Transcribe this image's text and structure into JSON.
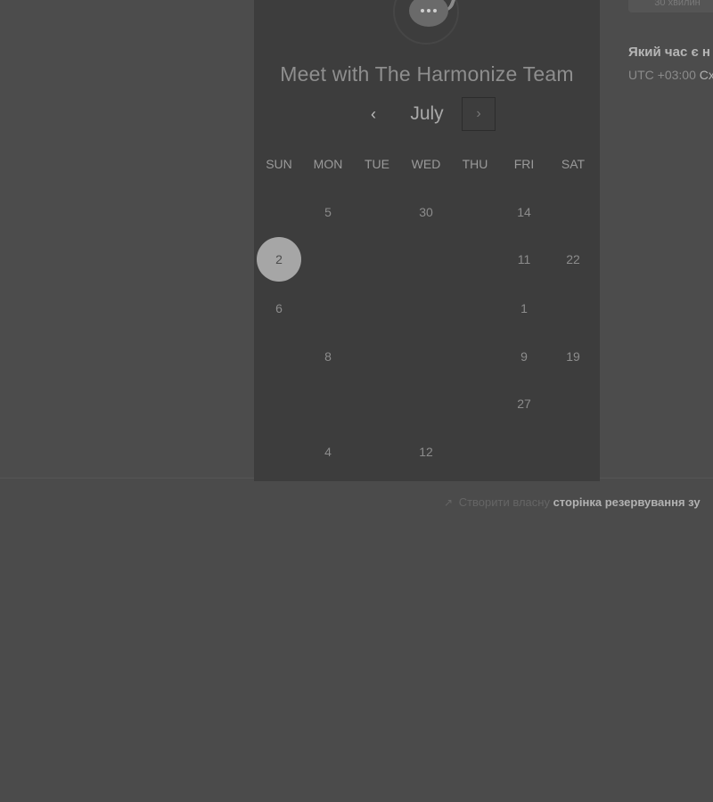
{
  "panel": {
    "title": "Meet with The Harmonize Team",
    "month": "July",
    "prev_icon": "‹",
    "next_icon": "›",
    "weekdays": [
      "SUN",
      "MON",
      "TUE",
      "WED",
      "THU",
      "FRI",
      "SAT"
    ],
    "days": [
      {
        "label": "5",
        "column": "MON",
        "row": 1,
        "selected": false
      },
      {
        "label": "30",
        "column": "WED",
        "row": 1,
        "selected": false
      },
      {
        "label": "14",
        "column": "FRI",
        "row": 1,
        "selected": false
      },
      {
        "label": "2",
        "column": "SUN",
        "row": 2,
        "selected": true
      },
      {
        "label": "11",
        "column": "FRI",
        "row": 2,
        "selected": false
      },
      {
        "label": "22",
        "column": "SAT",
        "row": 2,
        "selected": false
      },
      {
        "label": "6",
        "column": "SUN",
        "row": 3,
        "selected": false
      },
      {
        "label": "1",
        "column": "FRI",
        "row": 3,
        "selected": false
      },
      {
        "label": "8",
        "column": "MON",
        "row": 4,
        "selected": false
      },
      {
        "label": "9",
        "column": "FRI",
        "row": 4,
        "selected": false
      },
      {
        "label": "19",
        "column": "SAT",
        "row": 4,
        "selected": false
      },
      {
        "label": "27",
        "column": "FRI",
        "row": 5,
        "selected": false
      },
      {
        "label": "4",
        "column": "MON",
        "row": 6,
        "selected": false
      },
      {
        "label": "12",
        "column": "WED",
        "row": 6,
        "selected": false
      }
    ]
  },
  "right_column": {
    "duration_chip": "30 хвилин",
    "question": "Який час є н",
    "timezone_prefix": "UTC +03:00",
    "timezone_suffix": "Сх"
  },
  "footer": {
    "icon": "↗",
    "prefix": "Створити власну",
    "link": "сторінка резервування зу"
  },
  "colors": {
    "page_background": "#4b4b4b",
    "panel_background": "#3d3d3d",
    "selected_day": "#a6a6a6"
  }
}
